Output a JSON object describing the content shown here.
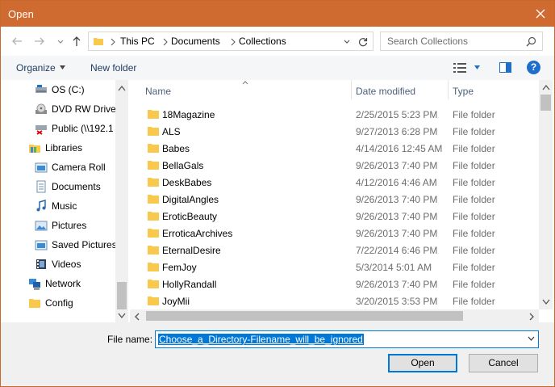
{
  "window": {
    "title": "Open"
  },
  "address": {
    "breadcrumbs": [
      "This PC",
      "Documents",
      "Collections"
    ]
  },
  "search": {
    "placeholder": "Search Collections"
  },
  "toolbar": {
    "organize_label": "Organize",
    "new_folder_label": "New folder"
  },
  "nav": {
    "items": [
      {
        "label": "OS (C:)",
        "icon": "drive-icon"
      },
      {
        "label": "DVD RW Drive",
        "icon": "dvd-drive-icon"
      },
      {
        "label": "Public (\\\\192.1",
        "icon": "network-drive-icon"
      },
      {
        "label": "Libraries",
        "icon": "libraries-icon"
      },
      {
        "label": "Camera Roll",
        "icon": "library-folder-icon"
      },
      {
        "label": "Documents",
        "icon": "documents-icon"
      },
      {
        "label": "Music",
        "icon": "music-icon"
      },
      {
        "label": "Pictures",
        "icon": "pictures-icon"
      },
      {
        "label": "Saved Pictures",
        "icon": "library-folder-icon"
      },
      {
        "label": "Videos",
        "icon": "videos-icon"
      },
      {
        "label": "Network",
        "icon": "network-icon"
      },
      {
        "label": "Config",
        "icon": "folder-icon"
      }
    ]
  },
  "columns": {
    "name": "Name",
    "date": "Date modified",
    "type": "Type"
  },
  "files": [
    {
      "name": "18Magazine",
      "date": "2/25/2015 5:23 PM",
      "type": "File folder"
    },
    {
      "name": "ALS",
      "date": "9/27/2013 6:28 PM",
      "type": "File folder"
    },
    {
      "name": "Babes",
      "date": "4/14/2016 12:45 AM",
      "type": "File folder"
    },
    {
      "name": "BellaGals",
      "date": "9/26/2013 7:40 PM",
      "type": "File folder"
    },
    {
      "name": "DeskBabes",
      "date": "4/12/2016 4:46 AM",
      "type": "File folder"
    },
    {
      "name": "DigitalAngles",
      "date": "9/26/2013 7:40 PM",
      "type": "File folder"
    },
    {
      "name": "EroticBeauty",
      "date": "9/26/2013 7:40 PM",
      "type": "File folder"
    },
    {
      "name": "ErroticaArchives",
      "date": "9/26/2013 7:40 PM",
      "type": "File folder"
    },
    {
      "name": "EternalDesire",
      "date": "7/22/2014 6:46 PM",
      "type": "File folder"
    },
    {
      "name": "FemJoy",
      "date": "5/3/2014 5:01 AM",
      "type": "File folder"
    },
    {
      "name": "HollyRandall",
      "date": "9/26/2013 7:40 PM",
      "type": "File folder"
    },
    {
      "name": "JoyMii",
      "date": "3/20/2015 3:53 PM",
      "type": "File folder"
    }
  ],
  "filename": {
    "label": "File name:",
    "value": "Choose_a_Directory-Filename_will_be_ignored"
  },
  "buttons": {
    "open": "Open",
    "cancel": "Cancel"
  },
  "colors": {
    "titlebar": "#cf6a30",
    "accent": "#0078d7",
    "folder": "#f8c94d"
  }
}
